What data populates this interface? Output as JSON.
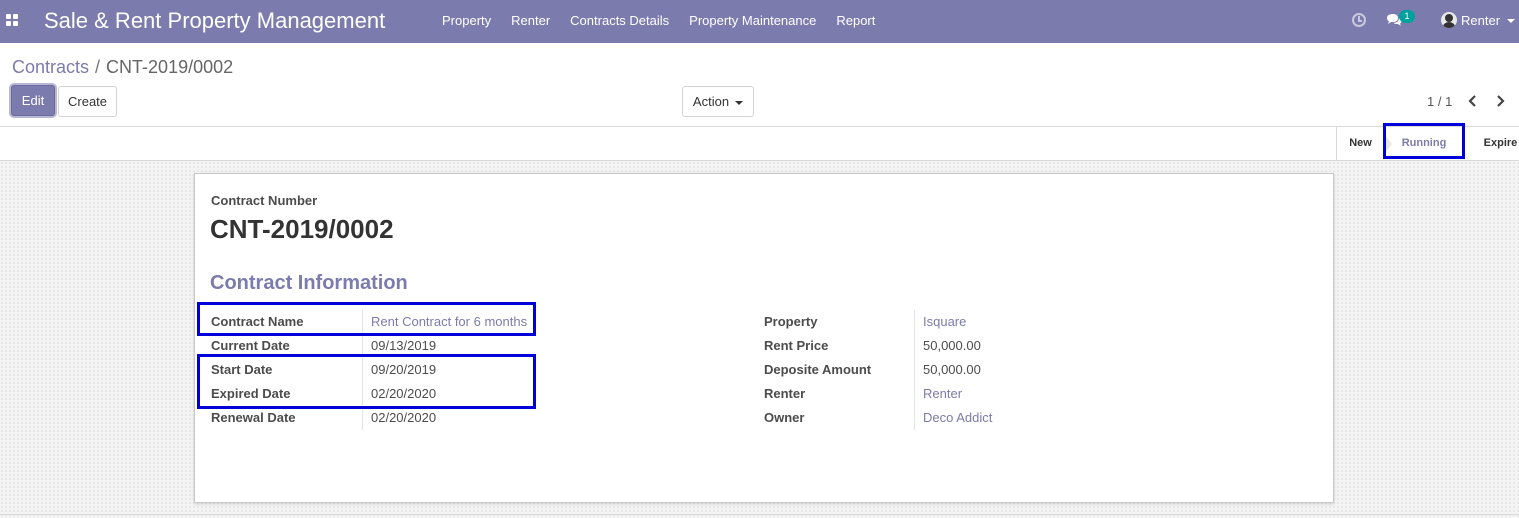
{
  "navbar": {
    "brand": "Sale & Rent Property Management",
    "menu": [
      "Property",
      "Renter",
      "Contracts Details",
      "Property Maintenance",
      "Report"
    ],
    "chat_badge": "1",
    "user_name": "Renter"
  },
  "breadcrumb": {
    "parent": "Contracts",
    "separator": "/",
    "current": "CNT-2019/0002"
  },
  "toolbar": {
    "edit_label": "Edit",
    "create_label": "Create",
    "action_label": "Action"
  },
  "pager": {
    "value": "1 / 1"
  },
  "statusbar": {
    "stages": [
      "New",
      "Running",
      "Expire"
    ],
    "active_stage": "Running"
  },
  "form": {
    "contract_number_label": "Contract Number",
    "contract_number": "CNT-2019/0002",
    "section_title": "Contract Information",
    "left_fields": [
      {
        "label": "Contract Name",
        "value": "Rent Contract for 6 months"
      },
      {
        "label": "Current Date",
        "value": "09/13/2019"
      },
      {
        "label": "Start Date",
        "value": "09/20/2019"
      },
      {
        "label": "Expired Date",
        "value": "02/20/2020"
      },
      {
        "label": "Renewal Date",
        "value": "02/20/2020"
      }
    ],
    "right_fields": [
      {
        "label": "Property",
        "value": "Isquare"
      },
      {
        "label": "Rent Price",
        "value": "50,000.00"
      },
      {
        "label": "Deposite Amount",
        "value": "50,000.00"
      },
      {
        "label": "Renter",
        "value": "Renter"
      },
      {
        "label": "Owner",
        "value": "Deco Addict"
      }
    ]
  },
  "colors": {
    "brand": "#7c7bad",
    "highlight": "#0000d8",
    "badge": "#00a09d"
  },
  "icons": [
    "apps-grid-icon",
    "clock-icon",
    "chat-icon",
    "user-avatar-icon",
    "caret-down-icon",
    "chevron-left-icon",
    "chevron-right-icon"
  ]
}
